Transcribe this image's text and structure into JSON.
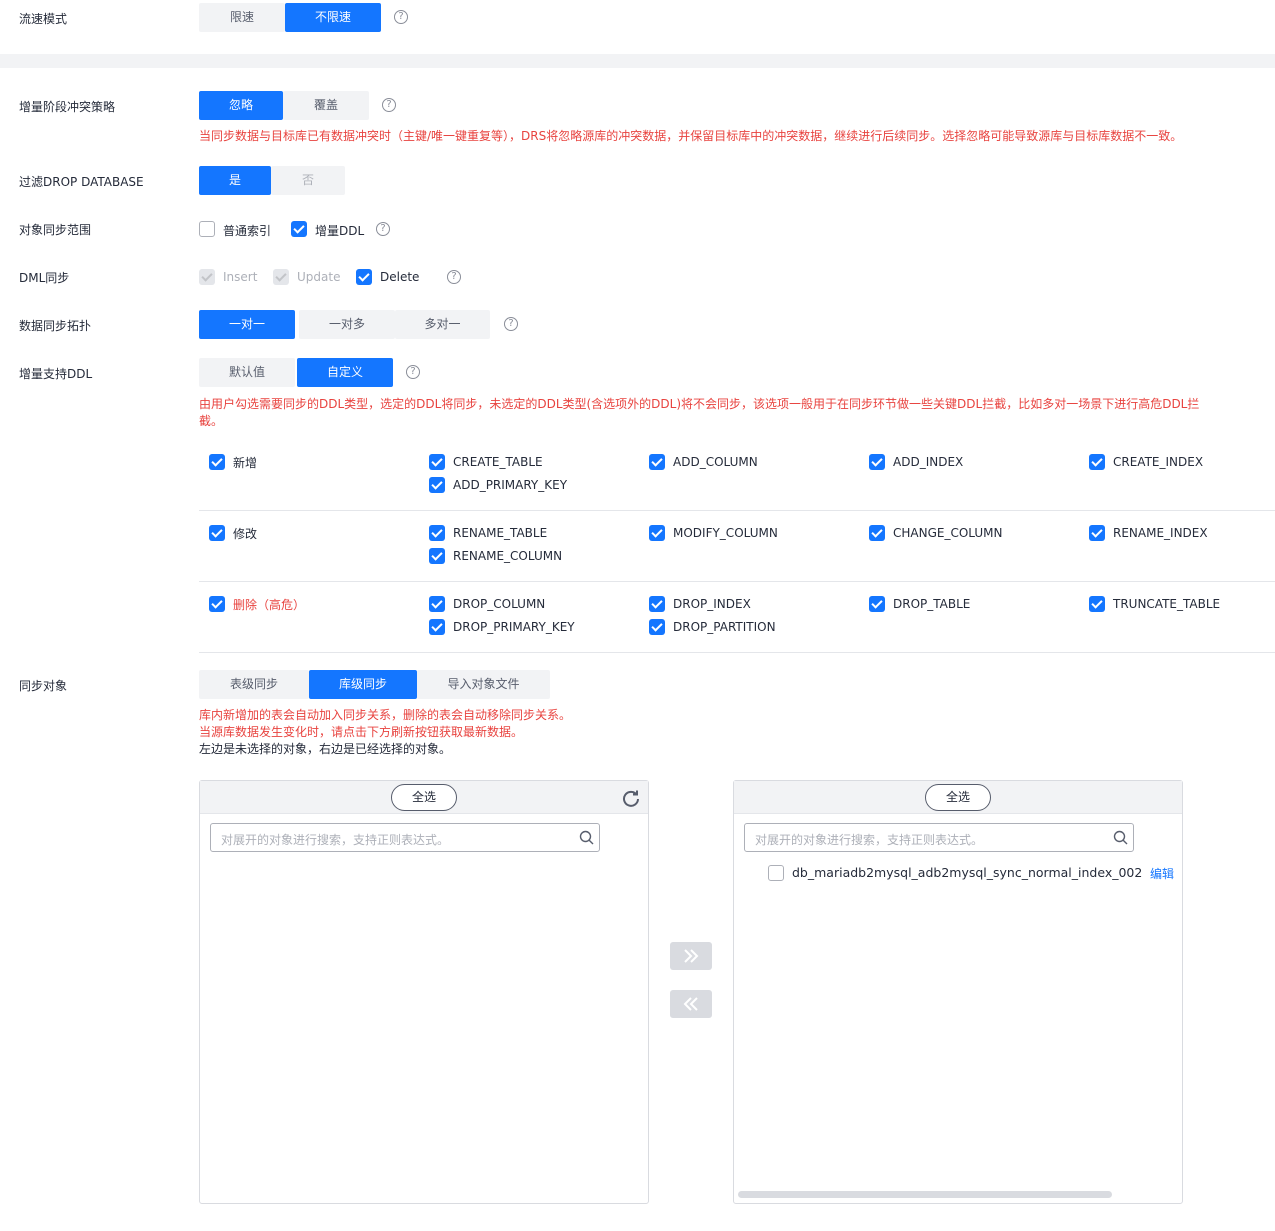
{
  "flow_mode": {
    "label": "流速模式",
    "options": [
      "限速",
      "不限速"
    ],
    "help": "?"
  },
  "conflict": {
    "label": "增量阶段冲突策略",
    "options": [
      "忽略",
      "覆盖"
    ],
    "help": "?",
    "note": "当同步数据与目标库已有数据冲突时（主键/唯一键重复等），DRS将忽略源库的冲突数据，并保留目标库中的冲突数据，继续进行后续同步。选择忽略可能导致源库与目标库数据不一致。"
  },
  "filter_drop": {
    "label": "过滤DROP DATABASE",
    "options": [
      "是",
      "否"
    ]
  },
  "object_scope": {
    "label": "对象同步范围",
    "items": [
      "普通索引",
      "增量DDL"
    ],
    "help": "?"
  },
  "dml": {
    "label": "DML同步",
    "items": [
      "Insert",
      "Update",
      "Delete"
    ],
    "help": "?"
  },
  "topology": {
    "label": "数据同步拓扑",
    "options": [
      "一对一",
      "一对多",
      "多对一"
    ],
    "help": "?"
  },
  "ddl": {
    "label": "增量支持DDL",
    "options": [
      "默认值",
      "自定义"
    ],
    "help": "?",
    "note_line1": "由用户勾选需要同步的DDL类型，选定的DDL将同步，未选定的DDL类型(含选项外的DDL)将不会同步，该选项一般用于在同步环节做一些关键DDL拦截，比如多对一场景下进行高危DDL拦",
    "note_line2": "截。",
    "groups": [
      {
        "name": "新增",
        "items": [
          "CREATE_TABLE",
          "ADD_COLUMN",
          "ADD_INDEX",
          "CREATE_INDEX",
          "ADD_PRIMARY_KEY"
        ]
      },
      {
        "name": "修改",
        "items": [
          "RENAME_TABLE",
          "MODIFY_COLUMN",
          "CHANGE_COLUMN",
          "RENAME_INDEX",
          "RENAME_COLUMN"
        ]
      },
      {
        "name": "删除（高危）",
        "items": [
          "DROP_COLUMN",
          "DROP_INDEX",
          "DROP_TABLE",
          "TRUNCATE_TABLE",
          "DROP_PRIMARY_KEY",
          "DROP_PARTITION"
        ]
      }
    ]
  },
  "sync_objects": {
    "label": "同步对象",
    "options": [
      "表级同步",
      "库级同步",
      "导入对象文件"
    ],
    "note1": "库内新增加的表会自动加入同步关系，删除的表会自动移除同步关系。",
    "note2": "当源库数据发生变化时，请点击下方刷新按钮获取最新数据。",
    "note3": "左边是未选择的对象，右边是已经选择的对象。",
    "left_panel": {
      "select_all": "全选",
      "placeholder": "对展开的对象进行搜索，支持正则表达式。"
    },
    "right_panel": {
      "select_all": "全选",
      "placeholder": "对展开的对象进行搜索，支持正则表达式。",
      "items": [
        {
          "name": "db_mariadb2mysql_adb2mysql_sync_normal_index_002",
          "action": "编辑"
        }
      ]
    }
  },
  "colors": {
    "primary": "#1476ff",
    "danger": "#e8433f",
    "link": "#1476ff"
  },
  "icons": [
    "help-icon",
    "check-icon",
    "search-icon",
    "refresh-icon",
    "double-right-icon",
    "double-left-icon"
  ]
}
